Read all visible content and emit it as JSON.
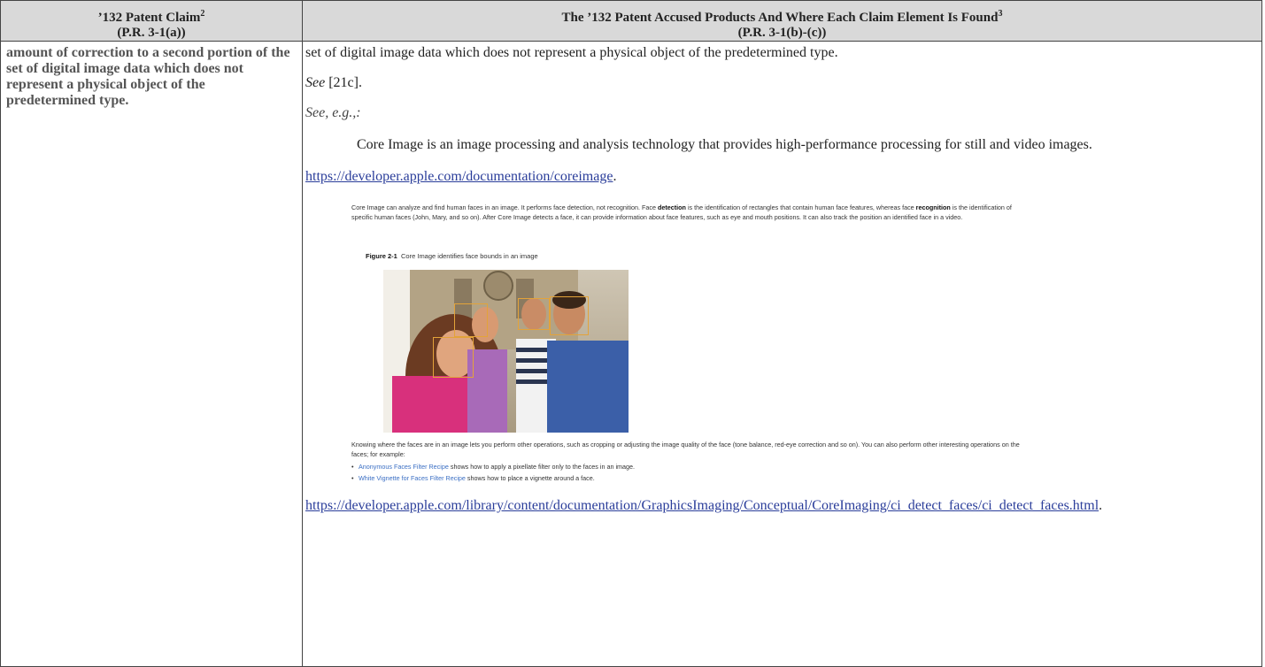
{
  "header": {
    "col1_line1": "’132 Patent Claim",
    "col1_sup": "2",
    "col1_line2": "(P.R. 3-1(a))",
    "col2_line1": "The ’132 Patent Accused Products And Where Each Claim Element Is Found",
    "col2_sup": "3",
    "col2_line2": "(P.R. 3-1(b)-(c))"
  },
  "claim": {
    "text": "amount of correction to a second portion of the set of digital image data which does not represent a physical object of the predetermined type."
  },
  "evidence": {
    "line1": "set of digital image data which does not represent a physical object of the predetermined type.",
    "see_label": "See",
    "see_ref": " [21c].",
    "see_eg": "See, e.g.,:",
    "quote": "Core Image is an image processing and analysis technology that provides high-performance processing for still and video images.",
    "url1": "https://developer.apple.com/documentation/coreimage",
    "url1_suffix": ".",
    "url2": "https://developer.apple.com/library/content/documentation/GraphicsImaging/Conceptual/CoreImaging/ci_detect_faces/ci_detect_faces.html",
    "url2_suffix": "."
  },
  "excerpt": {
    "para1_a": "Core Image can analyze and find human faces in an image. It performs face detection, not recognition. Face ",
    "para1_b": "detection",
    "para1_c": " is the identification of rectangles that contain human face features, whereas face ",
    "para1_d": "recognition",
    "para1_e": " is the identification of specific human faces (John, Mary, and so on). After Core Image detects a face, it can provide information about face features, such as eye and mouth positions. It can also track the position an identified face in a video.",
    "figure_label": "Figure 2-1",
    "figure_caption": "Core Image identifies face bounds in an image",
    "para2": "Knowing where the faces are in an image lets you perform other operations, such as cropping or adjusting the image quality of the face (tone balance, red-eye correction and so on). You can also perform other interesting operations on the faces; for example:",
    "bullet1_link": "Anonymous Faces Filter Recipe",
    "bullet1_text": " shows how to apply a pixellate filter only to the faces in an image.",
    "bullet2_link": "White Vignette for Faces Filter Recipe",
    "bullet2_text": " shows how to place a vignette around a face.",
    "bullet_glyph": "•"
  },
  "colors": {
    "header_bg": "#d9d9d9",
    "link": "#2a3d9a",
    "face_box": "#e3a33a"
  }
}
